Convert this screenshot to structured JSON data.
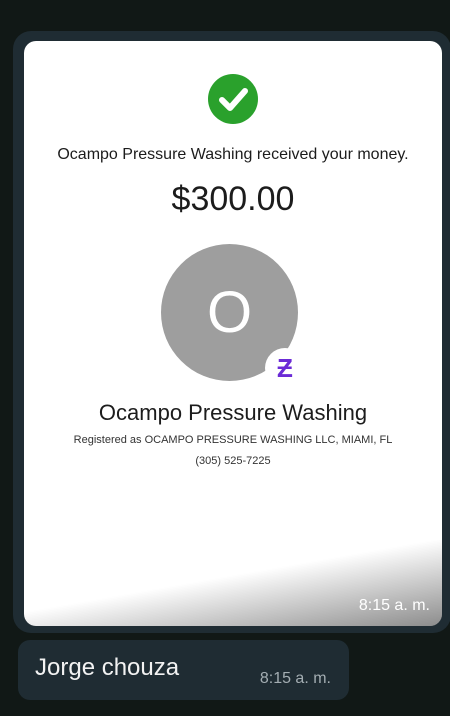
{
  "colors": {
    "check": "#2aa12c",
    "avatar_bg": "#9e9e9e",
    "cash_app_purple": "#6b2bd6",
    "bubble_bg": "#1f2c33"
  },
  "receipt": {
    "status_icon": "check-circle-icon",
    "received_message": "Ocampo Pressure Washing received your money.",
    "amount": "$300.00",
    "avatar_letter": "O",
    "badge_icon": "cash-app-icon",
    "badge_symbol": "Ƶ",
    "merchant_name": "Ocampo Pressure Washing",
    "registered_as": "Registered as OCAMPO PRESSURE WASHING LLC, MIAMI, FL",
    "phone": "(305) 525-7225"
  },
  "image_message": {
    "time": "8:15 a. m."
  },
  "text_message": {
    "text": "Jorge chouza",
    "time": "8:15 a. m."
  }
}
